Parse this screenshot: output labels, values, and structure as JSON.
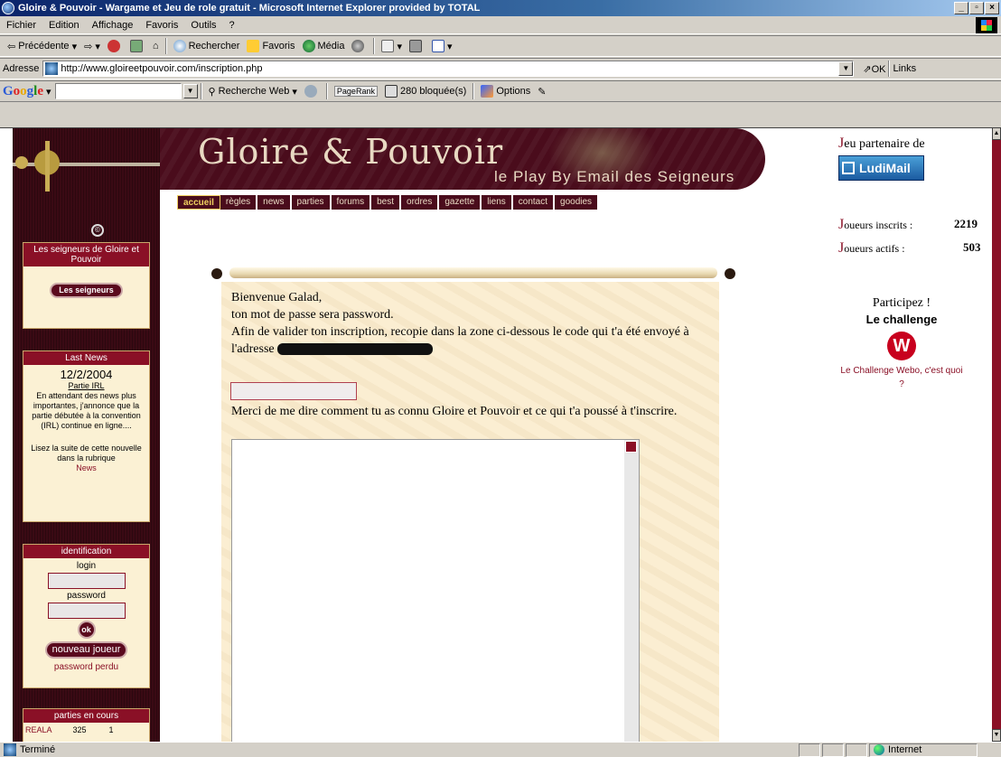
{
  "window": {
    "title": "Gloire & Pouvoir - Wargame et Jeu de role gratuit - Microsoft Internet Explorer provided by TOTAL"
  },
  "menu": [
    "Fichier",
    "Edition",
    "Affichage",
    "Favoris",
    "Outils",
    "?"
  ],
  "toolbar": {
    "back": "Précédente",
    "search": "Rechercher",
    "favorites": "Favoris",
    "media": "Média"
  },
  "address": {
    "label": "Adresse",
    "url": "http://www.gloireetpouvoir.com/inscription.php",
    "go": "OK",
    "links": "Links"
  },
  "google": {
    "search_web": "Recherche Web",
    "pagerank": "PageRank",
    "blocked": "280 bloquée(s)",
    "options": "Options"
  },
  "status": {
    "text": "Terminé",
    "zone": "Internet"
  },
  "header": {
    "title": "Gloire & Pouvoir",
    "subtitle": "le Play By Email des Seigneurs"
  },
  "nav": [
    "accueil",
    "règles",
    "news",
    "parties",
    "forums",
    "best",
    "ordres",
    "gazette",
    "liens",
    "contact",
    "goodies"
  ],
  "sidebar": {
    "seigneurs": {
      "title": "Les seigneurs de Gloire et Pouvoir",
      "button": "Les seigneurs"
    },
    "news": {
      "title": "Last News",
      "date": "12/2/2004",
      "headline": "Partie IRL",
      "body": "En attendant des news plus importantes, j'annonce que la partie débutée à la convention (IRL) continue en ligne....",
      "more": "Lisez la suite de cette nouvelle dans la rubrique",
      "link": "News"
    },
    "login": {
      "title": "identification",
      "login_label": "login",
      "password_label": "password",
      "ok": "ok",
      "new_player": "nouveau joueur",
      "lost": "password perdu"
    },
    "games": {
      "title": "parties en cours",
      "row": [
        "REALA",
        "325",
        "1"
      ]
    }
  },
  "main": {
    "line1": "Bienvenue Galad,",
    "line2": "ton mot de passe sera password.",
    "line3": "Afin de valider ton inscription, recopie dans la zone ci-dessous le code qui t'a été envoyé à l'adresse",
    "question": "Merci de me dire comment tu as connu Gloire et Pouvoir et ce qui t'a poussé à t'inscrire."
  },
  "right": {
    "partner": "eu partenaire de",
    "partner_cap": "J",
    "partner_logo": "LudiMail",
    "inscrits_cap": "J",
    "inscrits_label": "oueurs inscrits :",
    "inscrits_value": "2219",
    "actifs_cap": "J",
    "actifs_label": "oueurs actifs :",
    "actifs_value": "503",
    "challenge_title": "Participez !",
    "challenge_name": "Le challenge",
    "challenge_logo": "W",
    "challenge_link": "Le Challenge Webo, c'est quoi ?"
  }
}
